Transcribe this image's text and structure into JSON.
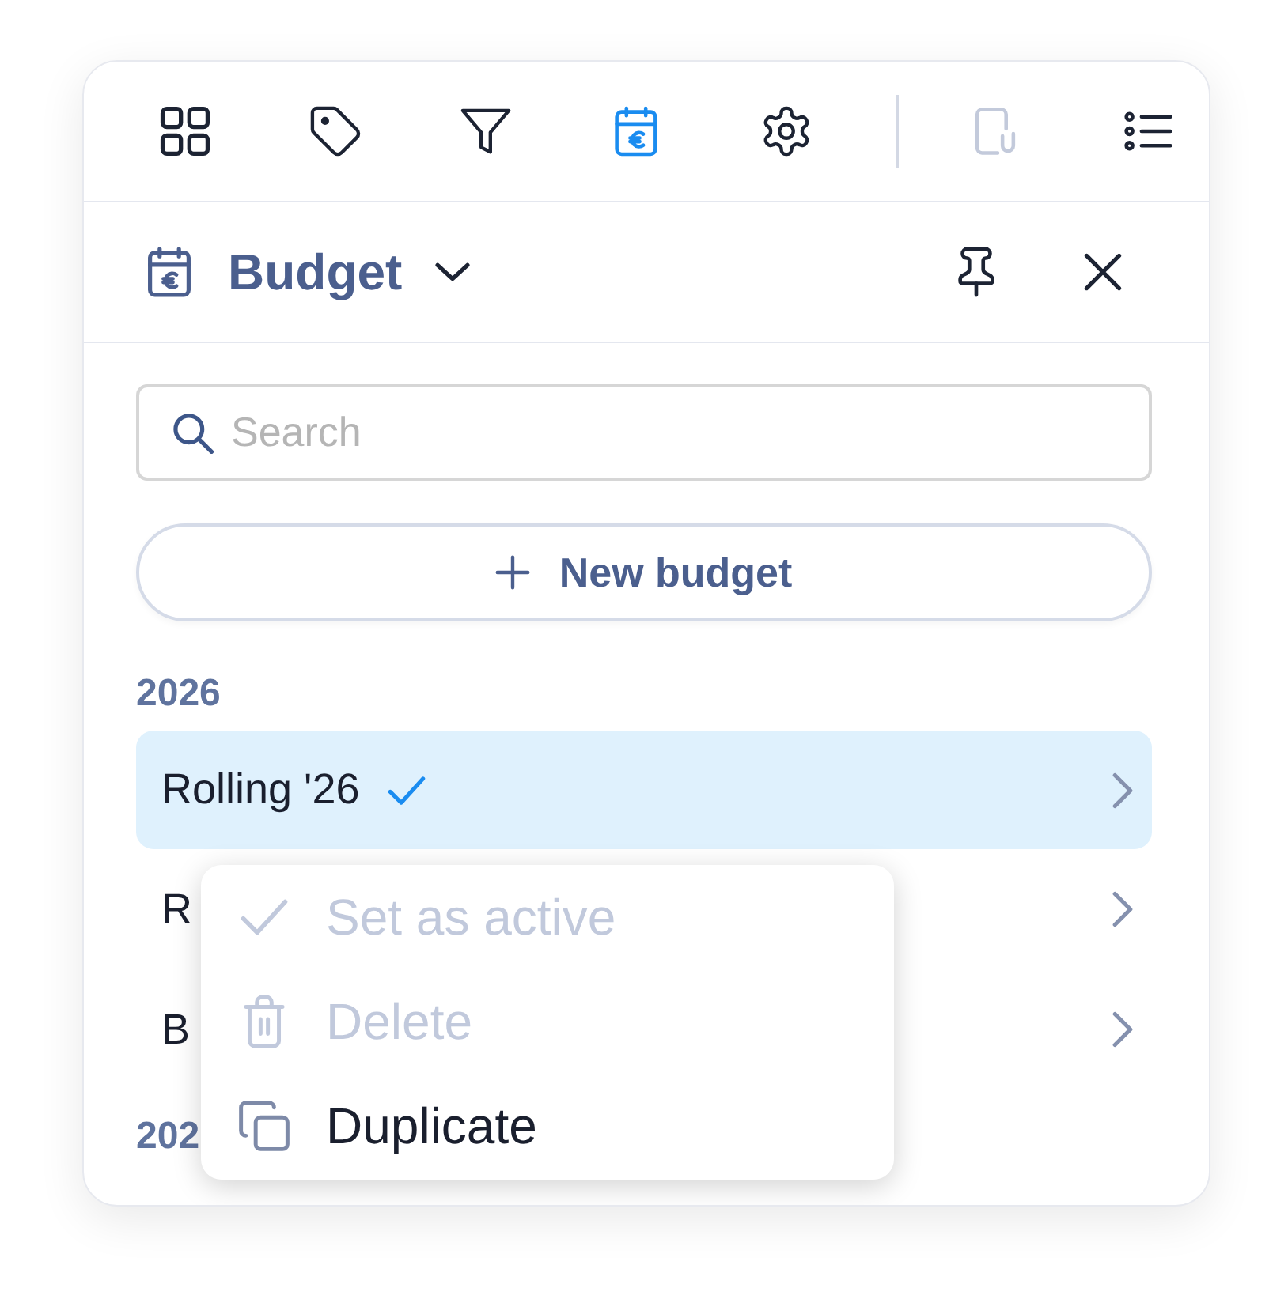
{
  "toolbar": {
    "items": [
      {
        "kind": "button",
        "selected": false,
        "disabled": false
      },
      {
        "kind": "button",
        "selected": false,
        "disabled": false
      },
      {
        "kind": "button",
        "selected": false,
        "disabled": false
      },
      {
        "kind": "button",
        "selected": true,
        "disabled": false
      },
      {
        "kind": "button",
        "selected": false,
        "disabled": false
      },
      {
        "kind": "separator"
      },
      {
        "kind": "button",
        "selected": false,
        "disabled": true
      },
      {
        "kind": "button",
        "selected": false,
        "disabled": false
      }
    ]
  },
  "panel": {
    "title": "Budget",
    "search": {
      "placeholder": "Search"
    },
    "new_button": {
      "label": "New budget"
    },
    "sections": [
      {
        "year": "2026",
        "items": [
          {
            "label": "Rolling '26",
            "selected": true,
            "active": true
          },
          {
            "label": "R",
            "selected": false,
            "active": false
          },
          {
            "label": "B",
            "selected": false,
            "active": false
          }
        ]
      },
      {
        "year": "202"
      }
    ]
  },
  "context_menu": {
    "items": [
      {
        "label": "Set as active",
        "disabled": true
      },
      {
        "label": "Delete",
        "disabled": true
      },
      {
        "label": "Duplicate",
        "disabled": false
      }
    ]
  }
}
